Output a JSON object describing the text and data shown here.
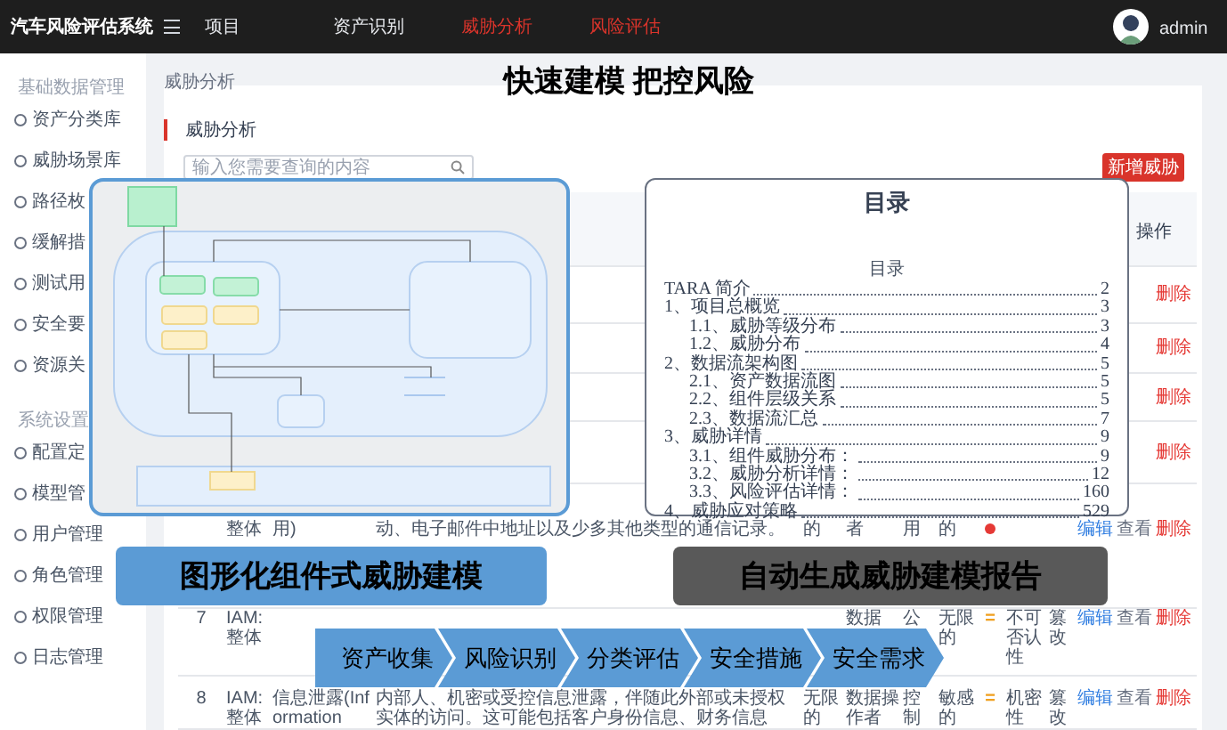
{
  "header": {
    "title": "汽车风险评估系统",
    "nav": [
      {
        "label": "项目",
        "highlighted": false
      },
      {
        "label": "资产识别",
        "highlighted": false
      },
      {
        "label": "威胁分析",
        "highlighted": true
      },
      {
        "label": "风险评估",
        "highlighted": true
      }
    ],
    "user": "admin"
  },
  "sidebar": {
    "sections": [
      {
        "title": "基础数据管理",
        "items": [
          "资产分类库",
          "威胁场景库",
          "路径枚",
          "缓解措",
          "测试用",
          "安全要",
          "资源关"
        ]
      },
      {
        "title": "系统设置",
        "items": [
          "配置定",
          "模型管",
          "用户管理",
          "角色管理",
          "权限管理",
          "日志管理"
        ]
      }
    ]
  },
  "breadcrumb": "威胁分析",
  "panel": {
    "title": "威胁分析",
    "search": {
      "placeholder": "输入您需要查询的内容"
    },
    "add_button": "新增威胁",
    "table": {
      "action_header": "操作",
      "rows": [
        {
          "actions": [
            {
              "label": "删除",
              "kind": "delete"
            }
          ]
        },
        {
          "actions": [
            {
              "label": "删除",
              "kind": "delete"
            }
          ]
        },
        {
          "actions": [
            {
              "label": "删除",
              "kind": "delete"
            }
          ]
        },
        {
          "actions": [
            {
              "label": "删除",
              "kind": "delete"
            }
          ]
        },
        {
          "subject": "整体",
          "threat": "用)",
          "description": "动、电子邮件中地址以及少多其他类型的通信记录。",
          "column_5": "的",
          "column_6": "者",
          "column_7": "用",
          "column_8": "的",
          "risk": {
            "color": "#e53935"
          },
          "actions": [
            {
              "label": "编辑",
              "kind": "edit"
            },
            {
              "label": "查看",
              "kind": "view"
            },
            {
              "label": "删除",
              "kind": "delete"
            }
          ]
        },
        {
          "index": "7",
          "subject": "IAM: 整体",
          "column_6": "数据",
          "column_7": "公",
          "column_8": "无限的",
          "risk": {
            "symbol": "=",
            "color": "#f0a020"
          },
          "column_10": "不可否认性",
          "column_11": "篡改",
          "actions": [
            {
              "label": "编辑",
              "kind": "edit"
            },
            {
              "label": "查看",
              "kind": "view"
            },
            {
              "label": "删除",
              "kind": "delete"
            }
          ]
        },
        {
          "index": "8",
          "subject": "IAM: 整体",
          "threat": "信息泄露(Information",
          "description": "内部人、机密或受控信息泄露，伴随此外部或未授权实体的访问。这可能包括客户身份信息、财务信息",
          "column_5": "无限的",
          "column_6": "数据操作者",
          "column_7": "控制",
          "column_8": "敏感的",
          "risk": {
            "symbol": "=",
            "color": "#f0a020"
          },
          "column_10": "机密性",
          "column_11": "篡改",
          "actions": [
            {
              "label": "编辑",
              "kind": "edit"
            },
            {
              "label": "查看",
              "kind": "view"
            },
            {
              "label": "删除",
              "kind": "delete"
            }
          ]
        }
      ]
    }
  },
  "headline": "快速建模 把控风险",
  "diagram_card": {
    "caption": "图形化组件式威胁建模"
  },
  "report_card": {
    "title": "目录",
    "subtitle": "目录",
    "toc": [
      {
        "label": "TARA 简介",
        "page": "2"
      },
      {
        "label": "1、项目总概览",
        "page": "3",
        "children": [
          {
            "label": "1.1、威胁等级分布",
            "page": "3"
          },
          {
            "label": "1.2、威胁分布",
            "page": "4"
          }
        ]
      },
      {
        "label": "2、数据流架构图",
        "page": "5",
        "children": [
          {
            "label": "2.1、资产数据流图",
            "page": "5"
          },
          {
            "label": "2.2、组件层级关系",
            "page": "5"
          },
          {
            "label": "2.3、数据流汇总",
            "page": "7"
          }
        ]
      },
      {
        "label": "3、威胁详情",
        "page": "9",
        "children": [
          {
            "label": "3.1、组件威胁分布：",
            "page": "9"
          },
          {
            "label": "3.2、威胁分析详情：",
            "page": "12"
          },
          {
            "label": "3.3、风险评估详情：",
            "page": "160"
          }
        ]
      },
      {
        "label": "4、威胁应对策略",
        "page": "529"
      }
    ],
    "caption": "自动生成威胁建模报告"
  },
  "process_steps": [
    "资产收集",
    "风险识别",
    "分类评估",
    "安全措施",
    "安全需求"
  ]
}
